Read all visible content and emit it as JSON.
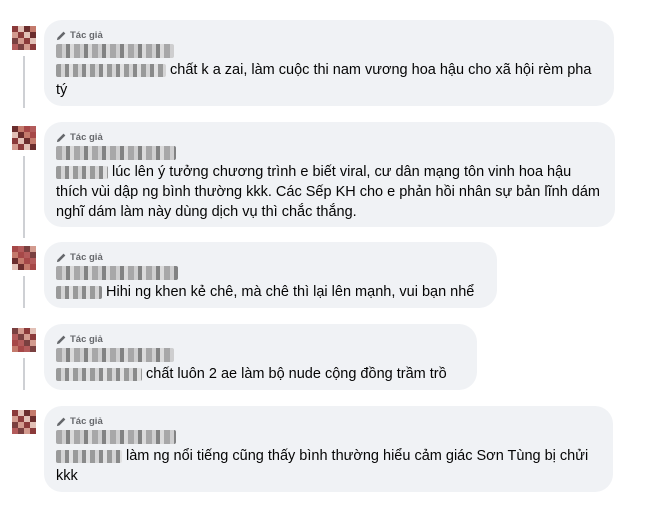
{
  "comments": [
    {
      "author_badge": "Tác giả",
      "text": "chất k a zai, làm cuộc thi nam vương hoa hậu cho xã hội rèm pha tý"
    },
    {
      "author_badge": "Tác giả",
      "text": "lúc lên ý tưởng chương trình e biết viral, cư dân mạng tôn vinh hoa hậu thích vùi dập ng bình thường kkk. Các Sếp KH cho e phản hồi nhân sự bản lĩnh dám nghĩ dám làm này dùng dịch vụ thì chắc thắng."
    },
    {
      "author_badge": "Tác giả",
      "text": "Hihi ng khen kẻ chê, mà chê thì lại lên mạnh, vui bạn nhể"
    },
    {
      "author_badge": "Tác giả",
      "text": "chất luôn 2 ae làm bộ nude cộng đồng trầm trồ"
    },
    {
      "author_badge": "Tác giả",
      "text": "làm ng nổi tiếng cũng thấy bình thường hiểu cảm giác Sơn Tùng bị chửi kkk"
    }
  ],
  "colors": {
    "bubble_bg": "#f0f2f5",
    "badge_text": "#65676b",
    "thread_line": "#ced0d4"
  },
  "icons": {
    "author_badge": "pencil-icon"
  }
}
